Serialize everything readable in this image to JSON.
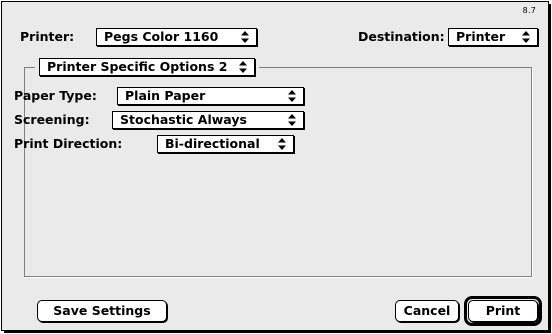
{
  "dialog": {
    "version": "8.7",
    "printer_label": "Printer:",
    "printer_value": "Pegs Color 1160",
    "destination_label": "Destination:",
    "destination_value": "Printer",
    "panel_value": "Printer Specific Options 2"
  },
  "options": {
    "paper_type_label": "Paper Type:",
    "paper_type_value": "Plain Paper",
    "screening_label": "Screening:",
    "screening_value": "Stochastic Always",
    "print_direction_label": "Print Direction:",
    "print_direction_value": "Bi-directional"
  },
  "buttons": {
    "save_settings": "Save Settings",
    "cancel": "Cancel",
    "print": "Print"
  },
  "icons": {
    "popup_arrows": "up-down-arrows-icon"
  }
}
